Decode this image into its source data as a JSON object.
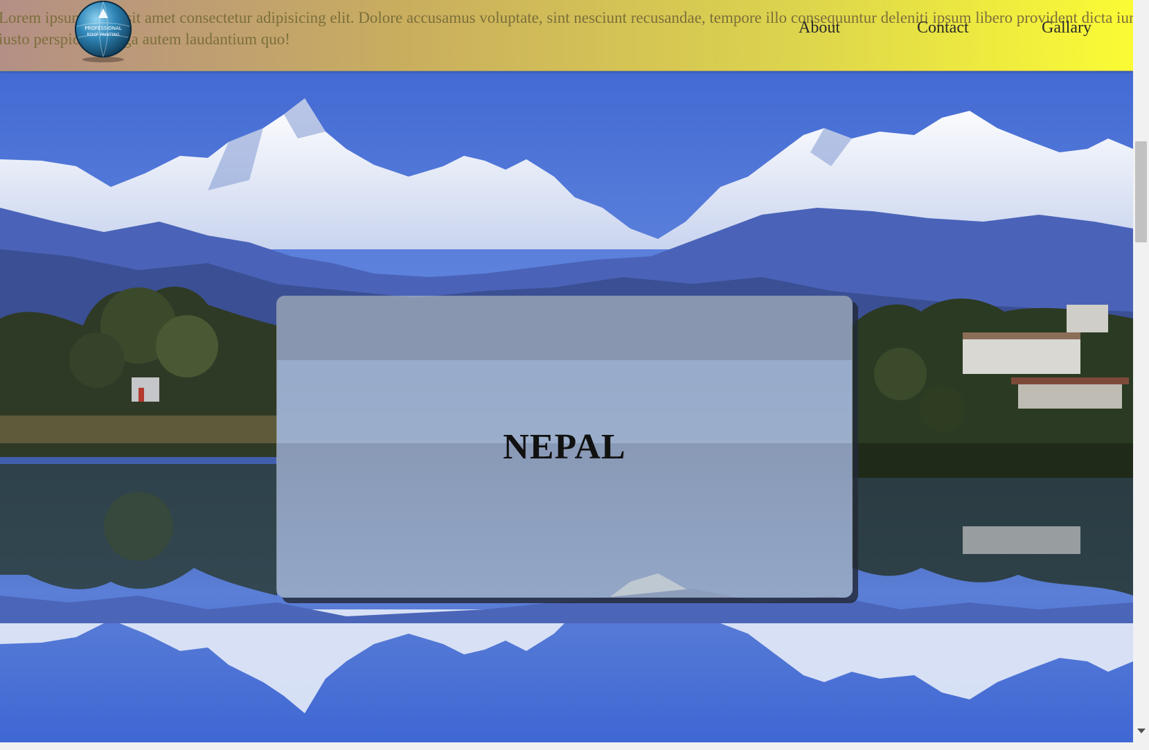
{
  "header": {
    "intro_text_line1": "Lorem ipsum dolor sit amet consectetur adipisicing elit. Dolore accusamus voluptate, sint nesciunt recusandae, tempore illo consequuntur deleniti ipsum libero provident dicta iure",
    "intro_text_line2": "iusto perspiciatis fuga autem laudantium quo!",
    "logo": {
      "name": "professional-roof-painting-logo",
      "line1": "PROFESSIONAL",
      "line2": "ROOF PAINTING"
    },
    "nav": [
      {
        "label": "About"
      },
      {
        "label": "Contact"
      },
      {
        "label": "Gallary"
      }
    ]
  },
  "hero": {
    "title": "NEPAL"
  },
  "colors": {
    "header_gradient_start": "#b48f86",
    "header_gradient_end": "#fbfb35",
    "sky_top": "#3c64d0",
    "sky_bottom": "#6f92e4",
    "card_background": "#b0babe",
    "card_shadow": "#232a37"
  },
  "icons": {
    "scroll_down": "chevron-down-icon"
  }
}
